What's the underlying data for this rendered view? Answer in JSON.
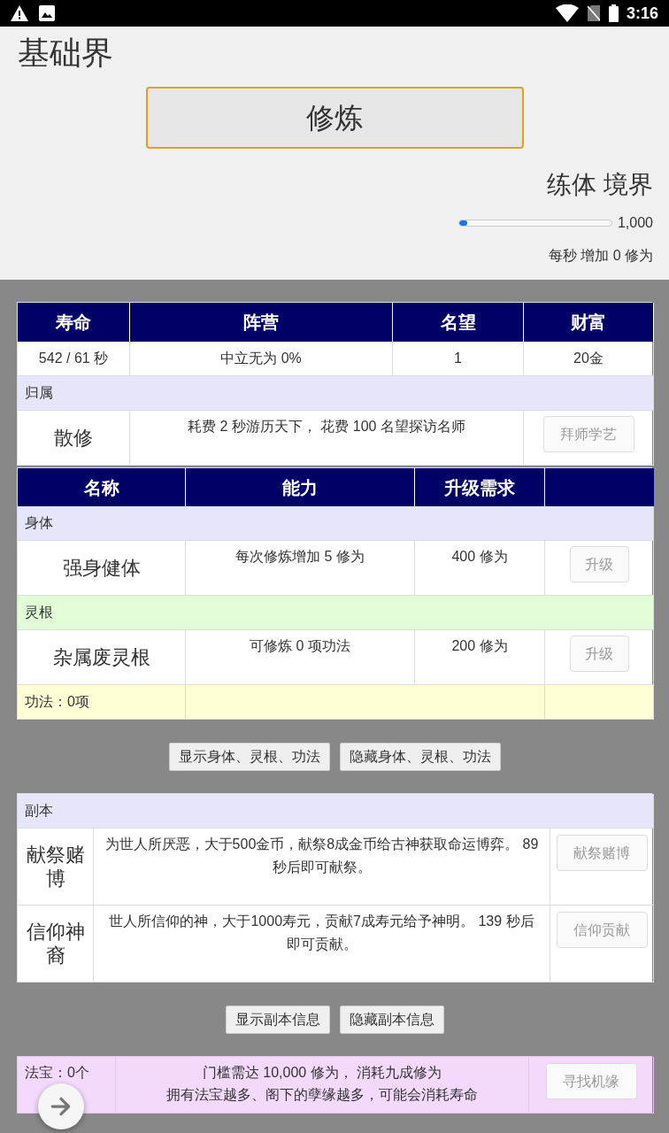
{
  "status_bar": {
    "time": "3:16"
  },
  "header": {
    "title": "基础界",
    "cultivate_button": "修炼",
    "realm": "练体 境界",
    "progress": {
      "level": 0.05,
      "reading": "1,000"
    },
    "rate": "每秒 增加 0 修为"
  },
  "stats": {
    "columns": [
      "寿命",
      "阵营",
      "名望",
      "财富"
    ],
    "values": [
      "542 / 61 秒",
      "中立无为 0%",
      "1",
      "20金"
    ]
  },
  "affiliation": {
    "section": "归属",
    "name": "散修",
    "description": "耗费 2 秒游历天下， 花费 100 名望探访名师",
    "button": {
      "label": "拜师学艺",
      "disabled": true
    }
  },
  "abilities": {
    "columns": [
      "名称",
      "能力",
      "升级需求"
    ],
    "sections": [
      {
        "label": "身体",
        "color": "#e6e6fa",
        "items": [
          {
            "name": "强身健体",
            "ability": "每次修炼增加 5 修为",
            "requirement": "400 修为",
            "button": {
              "label": "升级",
              "disabled": true
            }
          }
        ]
      },
      {
        "label": "灵根",
        "color": "#e2fcd8",
        "items": [
          {
            "name": "杂属废灵根",
            "ability": "可修炼 0 项功法",
            "requirement": "200 修为",
            "button": {
              "label": "升级",
              "disabled": true
            }
          }
        ]
      }
    ],
    "summary": "功法：0项"
  },
  "ability_toggles": [
    "显示身体、灵根、功法",
    "隐藏身体、灵根、功法"
  ],
  "dungeons": {
    "section": "副本",
    "rows": [
      {
        "name": "献祭赌博",
        "description": "为世人所厌恶，大于500金币，献祭8成金币给古神获取命运博弈。 89 秒后即可献祭。",
        "button": {
          "label": "献祭赌博",
          "disabled": true
        }
      },
      {
        "name": "信仰神裔",
        "description": "世人所信仰的神，大于1000寿元，贡献7成寿元给予神明。 139 秒后即可贡献。",
        "button": {
          "label": "信仰贡献",
          "disabled": true
        }
      }
    ]
  },
  "dungeon_toggles": [
    "显示副本信息",
    "隐藏副本信息"
  ],
  "treasure": {
    "label": "法宝：0个",
    "lines": [
      "门槛需达 10,000 修为， 消耗九成修为",
      "拥有法宝越多、阁下的孽缘越多，可能会消耗寿命"
    ],
    "button": {
      "label": "寻找机缘",
      "disabled": true
    }
  }
}
